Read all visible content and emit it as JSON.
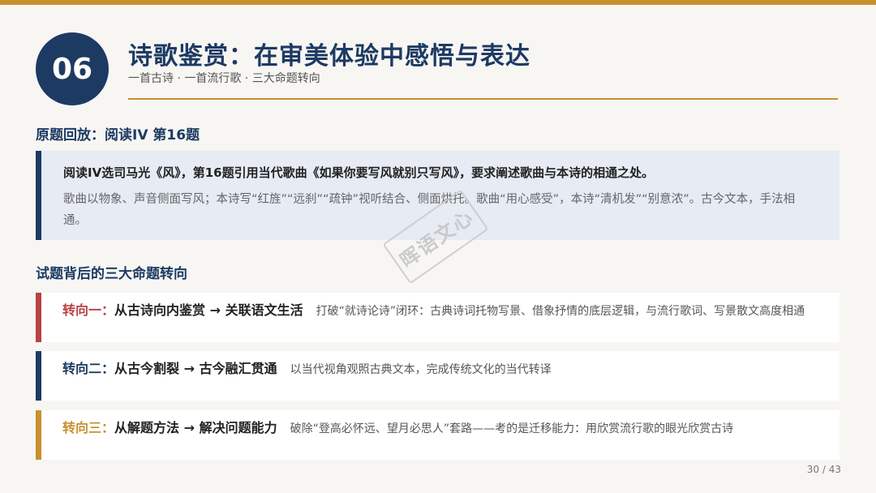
{
  "slide": {
    "number": "06",
    "title": "诗歌鉴赏：在审美体验中感悟与表达",
    "subtitle": "一首古诗 · 一首流行歌 · 三大命题转向",
    "page": "30 / 43"
  },
  "recap": {
    "heading": "原题回放：阅读IV 第16题",
    "lead": "阅读IV选司马光《风》，第16题引用当代歌曲《如果你要写风就别只写风》，要求阐述歌曲与本诗的相通之处。",
    "body": "歌曲以物象、声音侧面写风；本诗写“红旌”“远刹”“疏钟”视听结合、侧面烘托。歌曲“用心感受”，本诗“清机发”“别意浓”。古今文本，手法相通。"
  },
  "shifts": {
    "heading": "试题背后的三大命题转向",
    "items": [
      {
        "label": "转向一：",
        "head": "从古诗向内鉴赏 → 关联语文生活",
        "desc": "打破“就诗论诗”闭环：古典诗词托物写景、借象抒情的底层逻辑，与流行歌词、写景散文高度相通"
      },
      {
        "label": "转向二：",
        "head": "从古今割裂 → 古今融汇贯通",
        "desc": "以当代视角观照古典文本，完成传统文化的当代转译"
      },
      {
        "label": "转向三：",
        "head": "从解题方法 → 解决问题能力",
        "desc": "破除“登高必怀远、望月必思人”套路——考的是迁移能力：用欣赏流行歌的眼光欣赏古诗"
      }
    ]
  },
  "watermark": "晖语文心",
  "colors": {
    "navy": "#1d3a63",
    "gold": "#c8902e",
    "red": "#b94141",
    "recap_bg": "#e6ebf4"
  }
}
